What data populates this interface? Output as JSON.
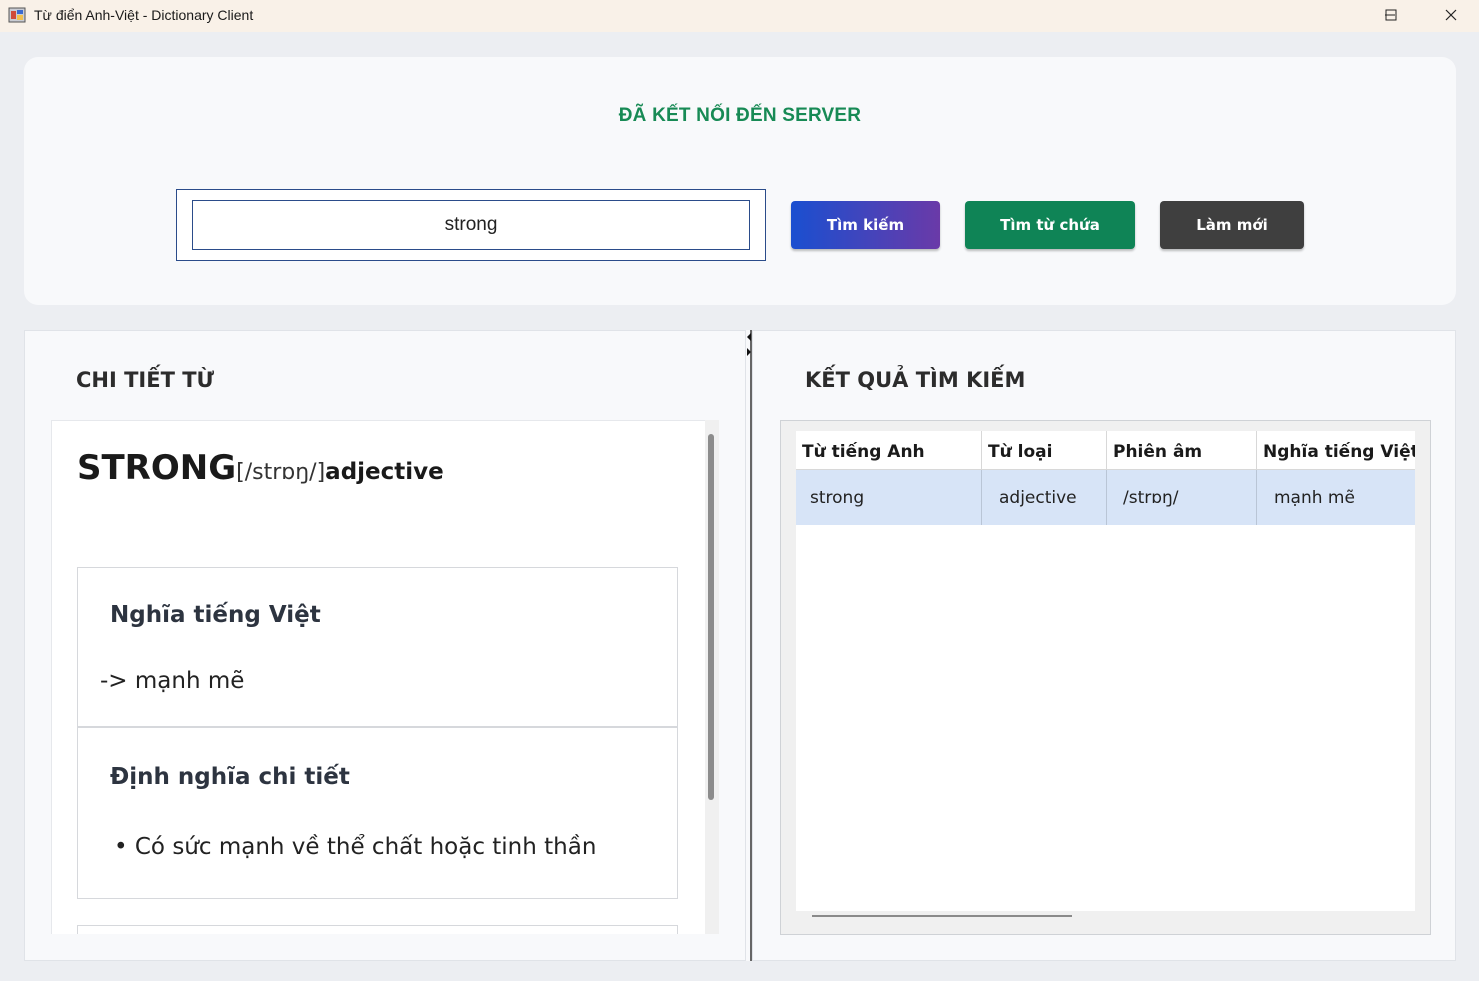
{
  "window": {
    "title": "Từ điển Anh-Việt - Dictionary Client"
  },
  "header": {
    "status": "ĐÃ KẾT NỐI ĐẾN SERVER",
    "status_color": "#178a55",
    "search_value": "strong",
    "buttons": {
      "search": "Tìm kiếm",
      "contains": "Tìm từ chứa",
      "refresh": "Làm mới"
    }
  },
  "detail": {
    "section_title": "CHI TIẾT TỪ",
    "word": "STRONG",
    "phonetic": "[/strɒŋ/]",
    "part_of_speech": "adjective",
    "cards": [
      {
        "title": "Nghĩa tiếng Việt",
        "body": "-> mạnh mẽ"
      },
      {
        "title": "Định nghĩa chi tiết",
        "body": "• Có sức mạnh về thể chất hoặc tinh thần"
      }
    ]
  },
  "results": {
    "section_title": "KẾT QUẢ TÌM KIẾM",
    "columns": [
      "Từ tiếng Anh",
      "Từ loại",
      "Phiên âm",
      "Nghĩa tiếng Việt"
    ],
    "rows": [
      [
        "strong",
        "adjective",
        "/strɒŋ/",
        "mạnh mẽ"
      ]
    ],
    "selected_row_color": "#d7e4f7"
  }
}
